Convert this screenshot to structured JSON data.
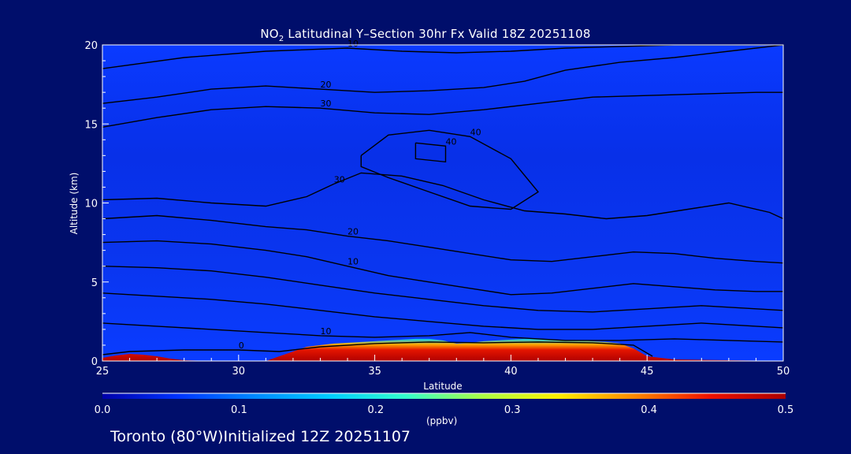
{
  "chart_data": {
    "type": "heatmap",
    "title": {
      "prefix": "NO",
      "sub": "2",
      "suffix": " Latitudinal Y–Section 30hr  Fx Valid 18Z 20251108"
    },
    "xlabel": "Latitude",
    "ylabel": "Altitude (km)",
    "xlim": [
      25,
      50
    ],
    "ylim": [
      0,
      20
    ],
    "x_ticks": [
      "25",
      "30",
      "35",
      "40",
      "45",
      "50"
    ],
    "y_ticks": [
      "0",
      "5",
      "10",
      "15",
      "20"
    ],
    "colorbar": {
      "range": [
        0.0,
        0.5
      ],
      "ticks": [
        "0.0",
        "0.1",
        "0.2",
        "0.3",
        "0.4",
        "0.5"
      ],
      "units": "(ppbv)",
      "colors": [
        "#0000aa",
        "#0033ff",
        "#0088ff",
        "#00ccff",
        "#33ffcc",
        "#aaff44",
        "#ffee00",
        "#ff8800",
        "#ee1100",
        "#aa0000"
      ]
    },
    "surface_no2": {
      "latitude": [
        25,
        25.5,
        26,
        26.5,
        27,
        27.5,
        28,
        29,
        30,
        31,
        31.5,
        32,
        32.5,
        33,
        33.5,
        34,
        34.5,
        35,
        35.5,
        36,
        36.5,
        37,
        37.5,
        38,
        38.5,
        39,
        39.5,
        40,
        40.5,
        41,
        41.5,
        42,
        42.5,
        43,
        43.5,
        44,
        44.5,
        45,
        46,
        48,
        50
      ],
      "no2_ppbv": [
        0.2,
        0.45,
        0.5,
        0.48,
        0.4,
        0.25,
        0.1,
        0.05,
        0.05,
        0.06,
        0.15,
        0.3,
        0.45,
        0.5,
        0.5,
        0.5,
        0.5,
        0.5,
        0.5,
        0.5,
        0.5,
        0.5,
        0.45,
        0.4,
        0.45,
        0.5,
        0.5,
        0.5,
        0.5,
        0.5,
        0.5,
        0.5,
        0.5,
        0.5,
        0.5,
        0.5,
        0.4,
        0.2,
        0.08,
        0.05,
        0.04
      ],
      "depth_km": [
        0.2,
        0.35,
        0.45,
        0.4,
        0.3,
        0.15,
        0.05,
        0.0,
        0.0,
        0.0,
        0.3,
        0.6,
        0.9,
        1.0,
        1.1,
        1.15,
        1.2,
        1.25,
        1.3,
        1.35,
        1.4,
        1.4,
        1.3,
        1.1,
        1.15,
        1.25,
        1.3,
        1.35,
        1.4,
        1.4,
        1.35,
        1.3,
        1.3,
        1.25,
        1.2,
        1.1,
        0.8,
        0.3,
        0.1,
        0.05,
        0.0
      ]
    },
    "background_no2_ppbv": 0.03,
    "contours": [
      {
        "label": "10",
        "lat": [
          25,
          28,
          31,
          34,
          36,
          38,
          40,
          42,
          44,
          46,
          48,
          50
        ],
        "alt": [
          18.5,
          19.2,
          19.6,
          19.8,
          19.6,
          19.5,
          19.6,
          19.8,
          19.9,
          20,
          20,
          20
        ]
      },
      {
        "label": "20",
        "lat": [
          25,
          27,
          29,
          31,
          33,
          35,
          37,
          39,
          40.5,
          42,
          44,
          46,
          48,
          50
        ],
        "alt": [
          16.3,
          16.7,
          17.2,
          17.4,
          17.2,
          17.0,
          17.1,
          17.3,
          17.7,
          18.4,
          18.9,
          19.2,
          19.6,
          20
        ]
      },
      {
        "label": "30",
        "lat": [
          25,
          27,
          29,
          31,
          33,
          35,
          37,
          39,
          41,
          43,
          45,
          47,
          49,
          50
        ],
        "alt": [
          14.8,
          15.4,
          15.9,
          16.1,
          16.0,
          15.7,
          15.6,
          15.9,
          16.3,
          16.7,
          16.8,
          16.9,
          17.0,
          17.0
        ]
      },
      {
        "label": "40",
        "lat": [
          34.5,
          35.5,
          37,
          38.5,
          40,
          41,
          40,
          38.5,
          37,
          35.5,
          34.5,
          34.5
        ],
        "alt": [
          13.0,
          14.3,
          14.6,
          14.2,
          12.8,
          10.7,
          9.6,
          9.8,
          10.7,
          11.6,
          12.3,
          13.0
        ]
      },
      {
        "label": "40",
        "lat": [
          36.5,
          37.6,
          37.6,
          36.5,
          36.5
        ],
        "alt": [
          13.8,
          13.6,
          12.6,
          12.8,
          13.8
        ]
      },
      {
        "label": "30",
        "lat": [
          25,
          27,
          29,
          31,
          32.5,
          33.5,
          34.5,
          36,
          37.5,
          39,
          40.5,
          42,
          43.5,
          45,
          46.5,
          48,
          49.5,
          50
        ],
        "alt": [
          10.2,
          10.3,
          10.0,
          9.8,
          10.4,
          11.2,
          11.9,
          11.7,
          11.1,
          10.2,
          9.5,
          9.3,
          9.0,
          9.2,
          9.6,
          10.0,
          9.4,
          9.0
        ]
      },
      {
        "label": "20",
        "lat": [
          25,
          27,
          29,
          31,
          32.5,
          34,
          35.5,
          37,
          38.5,
          40,
          41.5,
          43,
          44.5,
          46,
          47.5,
          49,
          50
        ],
        "alt": [
          9.0,
          9.2,
          8.9,
          8.5,
          8.3,
          7.9,
          7.6,
          7.2,
          6.8,
          6.4,
          6.3,
          6.6,
          6.9,
          6.8,
          6.5,
          6.3,
          6.2
        ]
      },
      {
        "label": "10",
        "lat": [
          25,
          27,
          29,
          31,
          32.5,
          34,
          35.5,
          37,
          38.5,
          40,
          41.5,
          43,
          44.5,
          46,
          47.5,
          49,
          50
        ],
        "alt": [
          7.5,
          7.6,
          7.4,
          7.0,
          6.6,
          6.0,
          5.4,
          5.0,
          4.6,
          4.2,
          4.3,
          4.6,
          4.9,
          4.7,
          4.5,
          4.4,
          4.4
        ]
      },
      {
        "label": "",
        "lat": [
          25,
          27,
          29,
          31,
          33,
          35,
          37,
          39,
          41,
          43,
          45,
          47,
          49,
          50
        ],
        "alt": [
          6.0,
          5.9,
          5.7,
          5.3,
          4.8,
          4.3,
          3.9,
          3.5,
          3.2,
          3.1,
          3.3,
          3.5,
          3.3,
          3.2
        ]
      },
      {
        "label": "",
        "lat": [
          25,
          27,
          29,
          31,
          33,
          35,
          37,
          39,
          41,
          43,
          45,
          47,
          49,
          50
        ],
        "alt": [
          4.3,
          4.1,
          3.9,
          3.6,
          3.2,
          2.8,
          2.5,
          2.2,
          2.0,
          2.0,
          2.2,
          2.4,
          2.2,
          2.1
        ]
      },
      {
        "label": "10",
        "lat": [
          25,
          27,
          29,
          31,
          33,
          35,
          37,
          38.5,
          40,
          42,
          44,
          46,
          48,
          50
        ],
        "alt": [
          2.4,
          2.2,
          2.0,
          1.8,
          1.6,
          1.5,
          1.6,
          1.8,
          1.5,
          1.3,
          1.3,
          1.4,
          1.3,
          1.2
        ]
      },
      {
        "label": "0",
        "lat": [
          25,
          26,
          28,
          30,
          31.5,
          33,
          35,
          37,
          39,
          41,
          43,
          44.5,
          45.2
        ],
        "alt": [
          0.4,
          0.6,
          0.7,
          0.7,
          0.6,
          0.9,
          1.1,
          1.2,
          1.15,
          1.2,
          1.15,
          1.0,
          0.3
        ]
      }
    ]
  },
  "footer": {
    "location": "Toronto (80°W)Initialized 12Z 20251107"
  }
}
